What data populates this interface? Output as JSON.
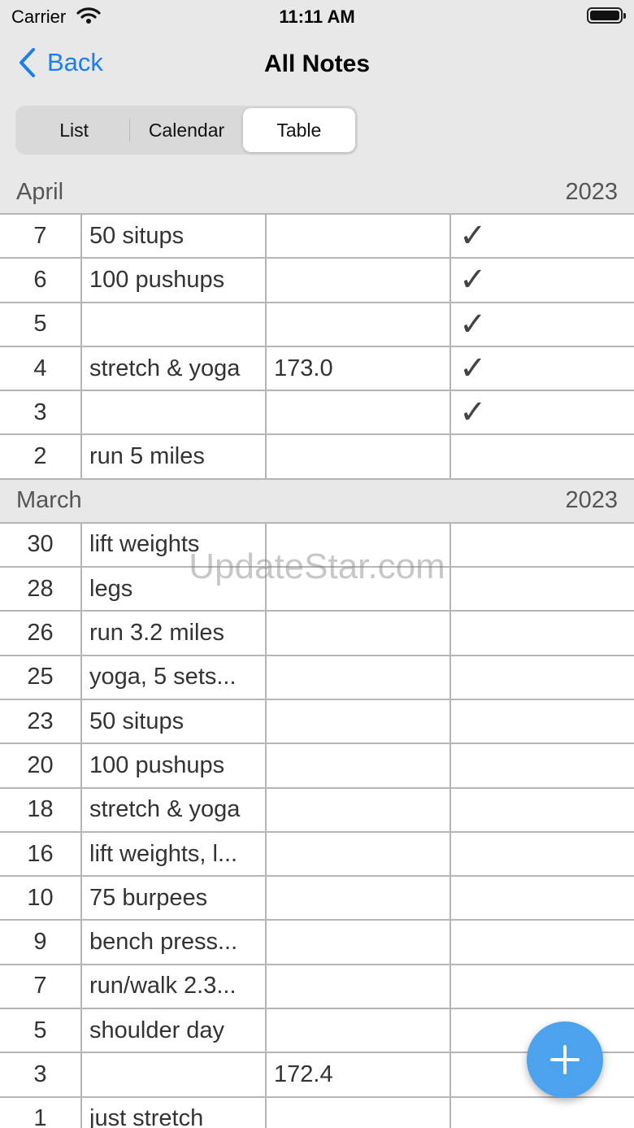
{
  "status": {
    "carrier": "Carrier",
    "time": "11:11 AM"
  },
  "nav": {
    "back_label": "Back",
    "title": "All Notes"
  },
  "segments": [
    "List",
    "Calendar",
    "Table"
  ],
  "selected_segment": "Table",
  "sections": [
    {
      "month": "April",
      "year": "2023",
      "rows": [
        {
          "day": "7",
          "note": "50 situps",
          "value": "",
          "check": "✓"
        },
        {
          "day": "6",
          "note": "100 pushups",
          "value": "",
          "check": "✓"
        },
        {
          "day": "5",
          "note": "",
          "value": "",
          "check": "✓"
        },
        {
          "day": "4",
          "note": "stretch & yoga",
          "value": "173.0",
          "check": "✓"
        },
        {
          "day": "3",
          "note": "",
          "value": "",
          "check": "✓"
        },
        {
          "day": "2",
          "note": "run 5 miles",
          "value": "",
          "check": ""
        }
      ]
    },
    {
      "month": "March",
      "year": "2023",
      "rows": [
        {
          "day": "30",
          "note": "lift weights",
          "value": "",
          "check": ""
        },
        {
          "day": "28",
          "note": "legs",
          "value": "",
          "check": ""
        },
        {
          "day": "26",
          "note": "run 3.2 miles",
          "value": "",
          "check": ""
        },
        {
          "day": "25",
          "note": "yoga, 5 sets...",
          "value": "",
          "check": ""
        },
        {
          "day": "23",
          "note": "50 situps",
          "value": "",
          "check": ""
        },
        {
          "day": "20",
          "note": "100 pushups",
          "value": "",
          "check": ""
        },
        {
          "day": "18",
          "note": "stretch & yoga",
          "value": "",
          "check": ""
        },
        {
          "day": "16",
          "note": "lift weights, l...",
          "value": "",
          "check": ""
        },
        {
          "day": "10",
          "note": "75 burpees",
          "value": "",
          "check": ""
        },
        {
          "day": "9",
          "note": "bench press...",
          "value": "",
          "check": ""
        },
        {
          "day": "7",
          "note": "run/walk 2.3...",
          "value": "",
          "check": ""
        },
        {
          "day": "5",
          "note": "shoulder day",
          "value": "",
          "check": ""
        },
        {
          "day": "3",
          "note": "",
          "value": "172.4",
          "check": ""
        },
        {
          "day": "1",
          "note": "just stretch",
          "value": "",
          "check": ""
        }
      ]
    }
  ],
  "watermark": "UpdateStar.com",
  "icons": {
    "wifi": "wifi-icon",
    "battery": "battery-icon",
    "back": "chevron-left-icon",
    "add": "plus-icon"
  },
  "colors": {
    "accent": "#1a7df2",
    "fab": "#4aa3ec",
    "header_bg": "#e8e8e8"
  }
}
